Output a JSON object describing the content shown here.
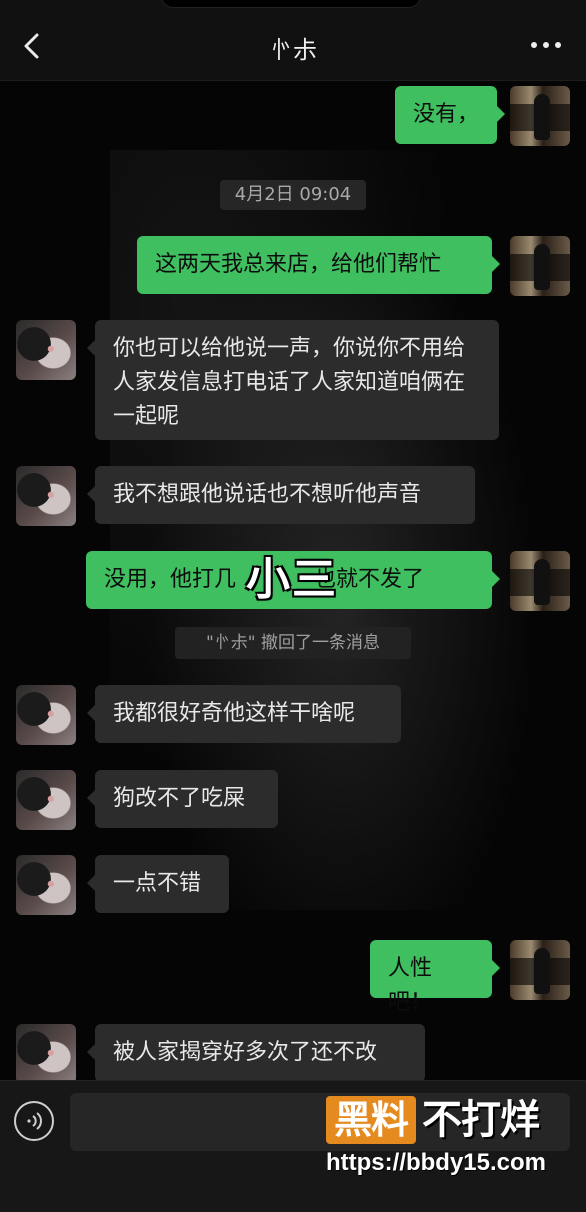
{
  "header": {
    "title": "㣺尗",
    "back_icon": "chevron-left-icon",
    "more_icon": "more-horizontal-icon"
  },
  "messages": [
    {
      "side": "out",
      "text": "没有，"
    },
    {
      "side": "out",
      "text": "这两天我总来店，给他们帮忙"
    },
    {
      "side": "in",
      "text": "你也可以给他说一声，你说你不用给人家发信息打电话了人家知道咱俩在一起呢"
    },
    {
      "side": "in",
      "text": "我不想跟他说话也不想听他声音"
    },
    {
      "side": "out",
      "text": "没用，他打几",
      "text_tail": "也就不发了"
    },
    {
      "side": "in",
      "text": "我都很好奇他这样干啥呢"
    },
    {
      "side": "in",
      "text": "狗改不了吃屎"
    },
    {
      "side": "in",
      "text": "一点不错"
    },
    {
      "side": "out",
      "text": "人性吧！"
    },
    {
      "side": "in",
      "text": "被人家揭穿好多次了还不改"
    }
  ],
  "timestamp": "4月2日 09:04",
  "system_message": "\"㣺尗\" 撤回了一条消息",
  "overlay_label": "小三",
  "input_bar": {
    "voice_icon": "voice-icon"
  },
  "watermark": {
    "logo_text": "黑料",
    "text": "不打烊",
    "url": "https://bbdy15.com"
  },
  "colors": {
    "outgoing_bubble": "#3fbf5f",
    "incoming_bubble": "#2c2c2c",
    "background": "#050505",
    "watermark_accent": "#e48a1e"
  }
}
